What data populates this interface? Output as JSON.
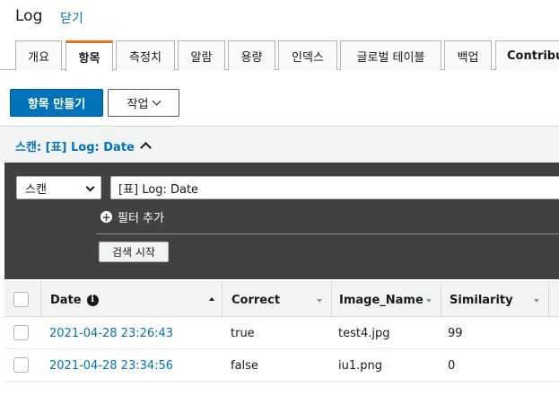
{
  "header": {
    "title": "Log",
    "close_label": "닫기"
  },
  "tabs": [
    {
      "label": "개요"
    },
    {
      "label": "항목"
    },
    {
      "label": "측정치"
    },
    {
      "label": "알람"
    },
    {
      "label": "용량"
    },
    {
      "label": "인덱스"
    },
    {
      "label": "글로벌 테이블"
    },
    {
      "label": "백업"
    },
    {
      "label": "Contributor Insights"
    }
  ],
  "active_tab": "항목",
  "toolbar": {
    "create_item_label": "항목 만들기",
    "actions_label": "작업"
  },
  "scan": {
    "header_label": "스캔: [표] Log: Date",
    "mode_value": "스캔",
    "target_value": "[표] Log: Date",
    "add_filter_label": "필터 추가",
    "start_search_label": "검색 시작"
  },
  "table": {
    "columns": [
      {
        "label": "Date"
      },
      {
        "label": "Correct"
      },
      {
        "label": "Image_Name"
      },
      {
        "label": "Similarity"
      }
    ],
    "rows": [
      {
        "date": "2021-04-28 23:26:43",
        "correct": "true",
        "image_name": "test4.jpg",
        "similarity": "99"
      },
      {
        "date": "2021-04-28 23:34:56",
        "correct": "false",
        "image_name": "iu1.png",
        "similarity": "0"
      }
    ]
  },
  "colors": {
    "accent": "#ec7211",
    "primary_button": "#0073bb",
    "link": "#0073bb",
    "panel_dark": "#414141"
  },
  "icons": {
    "add_filter": "plus-circle-icon",
    "date_info": "info-icon",
    "collapse": "chevron-up-icon"
  }
}
